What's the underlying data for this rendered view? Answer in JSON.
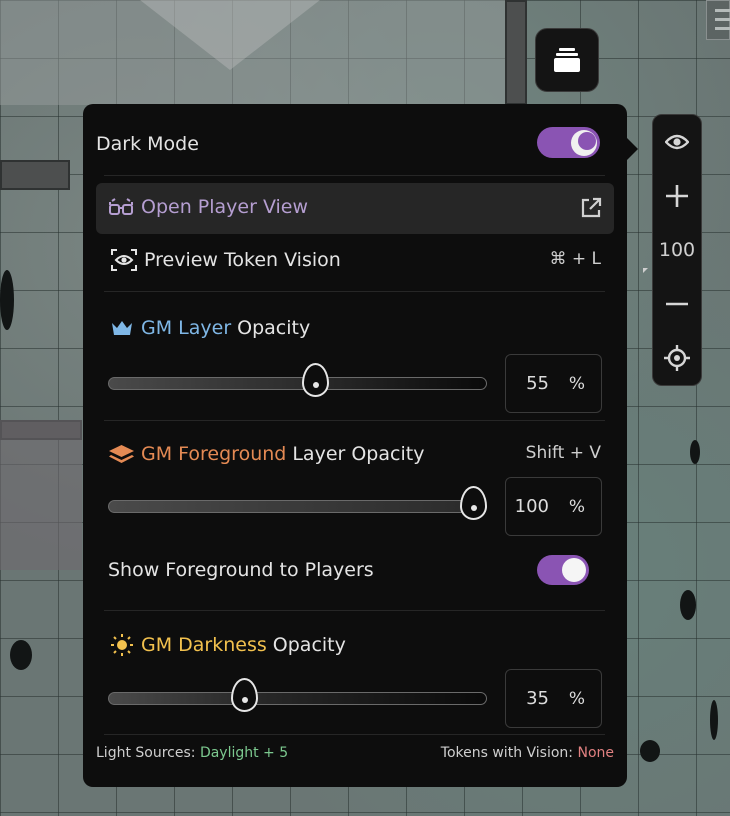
{
  "panel": {
    "dark_mode_label": "Dark Mode",
    "dark_mode_on": true,
    "open_player_view_label": "Open Player View",
    "preview_token_vision_label": "Preview Token Vision",
    "preview_token_vision_shortcut": "⌘ + L",
    "gm_layer": {
      "name": "GM Layer",
      "suffix": "Opacity",
      "value": "55",
      "unit": "%",
      "level": 0.55,
      "color": "#7fb7e6"
    },
    "gm_foreground": {
      "name": "GM Foreground",
      "suffix": "Layer Opacity",
      "shortcut": "Shift + V",
      "value": "100",
      "unit": "%",
      "level": 1.0,
      "color": "#e48a54"
    },
    "show_foreground_label": "Show Foreground to Players",
    "show_foreground_on": true,
    "gm_darkness": {
      "name": "GM Darkness",
      "suffix": "Opacity",
      "value": "35",
      "unit": "%",
      "level": 0.35,
      "color": "#f2c14e"
    },
    "footer": {
      "light_sources_label": "Light Sources:",
      "light_sources_value": "Daylight + 5",
      "tokens_label": "Tokens with Vision:",
      "tokens_value": "None"
    }
  },
  "zoom": {
    "value": "100"
  },
  "colors": {
    "accent_toggle": "#8a54b3",
    "panel_bg": "#0d0d0d",
    "daylight_green": "#7cc98f",
    "none_red": "#e08080"
  }
}
